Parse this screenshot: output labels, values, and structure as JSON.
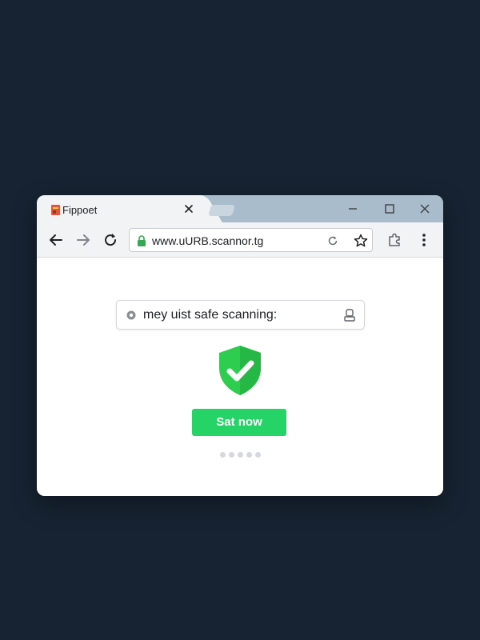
{
  "browser": {
    "tab": {
      "title": "Fippoet",
      "favicon": "page-favicon"
    },
    "address_bar": {
      "url": "www.uURB.scannor.tg"
    },
    "icons": {
      "back": "arrow-left-icon",
      "forward": "arrow-right-icon",
      "reload": "reload-icon",
      "lock": "lock-icon",
      "bookmark": "star-icon",
      "extensions": "puzzle-icon",
      "menu": "kebab-menu-icon"
    }
  },
  "page": {
    "search": {
      "value": "mey uist safe scanning:"
    },
    "shield": {
      "icon": "shield-check-icon",
      "color": "#2ecc4f"
    },
    "scan_button": {
      "label": "Sat now",
      "color": "#25d366"
    },
    "pagination": {
      "count": 5,
      "active_index": 0
    }
  },
  "colors": {
    "background": "#172332",
    "titlebar": "#a9bccb",
    "toolbar": "#f1f3f4"
  }
}
